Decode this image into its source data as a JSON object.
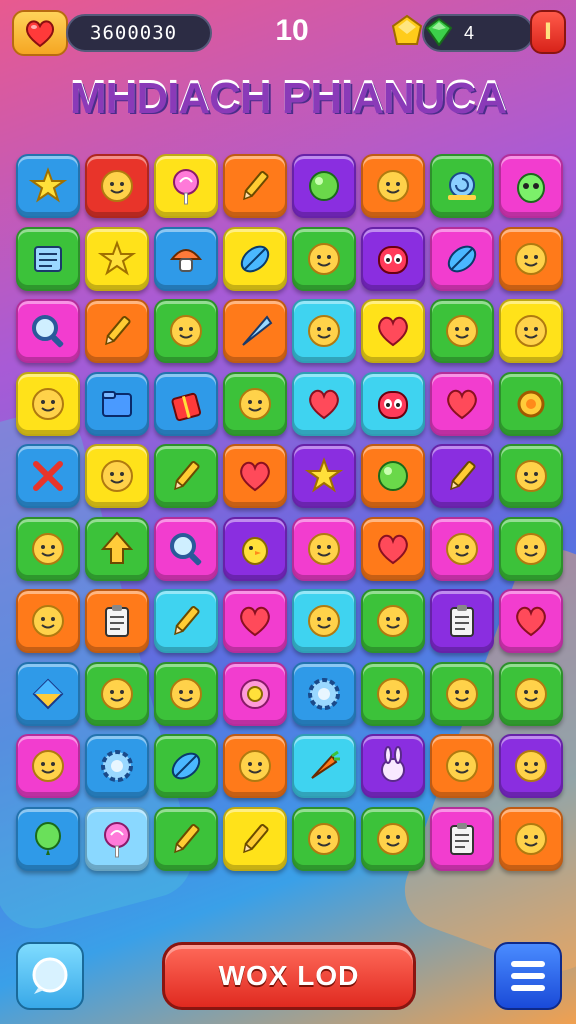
{
  "hud": {
    "score": "3600030",
    "level": "10",
    "gems": "4",
    "life_icon": "heart-icon",
    "gold_icon": "gold-gem-icon",
    "green_icon": "green-gem-icon",
    "close_label": "I"
  },
  "title": "MHDIACH PHIANUCA",
  "colors": {
    "blue": "#2f9ae8",
    "red": "#e8342a",
    "yellow": "#ffe21a",
    "orange": "#ff7a1a",
    "purple": "#8a2ee0",
    "green": "#3cc23a",
    "pink": "#f23dcf",
    "cyan": "#3fd3f0",
    "lightblue": "#8ad8ff"
  },
  "board": {
    "rows": [
      [
        {
          "c": "blue",
          "i": "star-icon"
        },
        {
          "c": "red",
          "i": "face-icon"
        },
        {
          "c": "yellow",
          "i": "lollipop-icon"
        },
        {
          "c": "orange",
          "i": "pencil-icon"
        },
        {
          "c": "purple",
          "i": "ball-icon"
        },
        {
          "c": "orange",
          "i": "face-icon"
        },
        {
          "c": "green",
          "i": "snail-icon"
        },
        {
          "c": "pink",
          "i": "alien-icon"
        }
      ],
      [
        {
          "c": "green",
          "i": "notepad-icon"
        },
        {
          "c": "yellow",
          "i": "star-icon"
        },
        {
          "c": "blue",
          "i": "mushroom-icon"
        },
        {
          "c": "yellow",
          "i": "leaf-icon"
        },
        {
          "c": "green",
          "i": "face-icon"
        },
        {
          "c": "purple",
          "i": "monster-icon"
        },
        {
          "c": "pink",
          "i": "leaf-icon"
        },
        {
          "c": "orange",
          "i": "face-icon"
        }
      ],
      [
        {
          "c": "pink",
          "i": "magnifier-icon"
        },
        {
          "c": "orange",
          "i": "pencil-icon"
        },
        {
          "c": "green",
          "i": "face-icon"
        },
        {
          "c": "orange",
          "i": "cone-icon"
        },
        {
          "c": "cyan",
          "i": "face-icon"
        },
        {
          "c": "yellow",
          "i": "heart-icon"
        },
        {
          "c": "green",
          "i": "face-icon"
        },
        {
          "c": "yellow",
          "i": "face-icon"
        }
      ],
      [
        {
          "c": "yellow",
          "i": "face-icon"
        },
        {
          "c": "blue",
          "i": "folder-icon"
        },
        {
          "c": "blue",
          "i": "gift-icon"
        },
        {
          "c": "green",
          "i": "face-icon"
        },
        {
          "c": "cyan",
          "i": "heart-icon"
        },
        {
          "c": "cyan",
          "i": "monster-icon"
        },
        {
          "c": "pink",
          "i": "heart-icon"
        },
        {
          "c": "green",
          "i": "ring-icon"
        }
      ],
      [
        {
          "c": "blue",
          "i": "cross-icon"
        },
        {
          "c": "yellow",
          "i": "face-icon"
        },
        {
          "c": "green",
          "i": "pencil-icon"
        },
        {
          "c": "orange",
          "i": "heart-icon"
        },
        {
          "c": "purple",
          "i": "star-icon"
        },
        {
          "c": "orange",
          "i": "ball-icon"
        },
        {
          "c": "purple",
          "i": "pencil-icon"
        },
        {
          "c": "green",
          "i": "face-icon"
        }
      ],
      [
        {
          "c": "green",
          "i": "face-icon"
        },
        {
          "c": "green",
          "i": "arrow-icon"
        },
        {
          "c": "pink",
          "i": "magnifier-icon"
        },
        {
          "c": "purple",
          "i": "chick-icon"
        },
        {
          "c": "pink",
          "i": "face-icon"
        },
        {
          "c": "orange",
          "i": "heart-icon"
        },
        {
          "c": "pink",
          "i": "face-icon"
        },
        {
          "c": "green",
          "i": "face-icon"
        }
      ],
      [
        {
          "c": "orange",
          "i": "face-icon"
        },
        {
          "c": "orange",
          "i": "clipboard-icon"
        },
        {
          "c": "cyan",
          "i": "pencil-icon"
        },
        {
          "c": "pink",
          "i": "heart-icon"
        },
        {
          "c": "cyan",
          "i": "face-icon"
        },
        {
          "c": "green",
          "i": "face-icon"
        },
        {
          "c": "purple",
          "i": "clipboard-icon"
        },
        {
          "c": "pink",
          "i": "heart-icon"
        }
      ],
      [
        {
          "c": "blue",
          "i": "diamond-icon"
        },
        {
          "c": "green",
          "i": "face-icon"
        },
        {
          "c": "green",
          "i": "face-icon"
        },
        {
          "c": "pink",
          "i": "flower-icon"
        },
        {
          "c": "blue",
          "i": "gear-icon"
        },
        {
          "c": "green",
          "i": "face-icon"
        },
        {
          "c": "green",
          "i": "face-icon"
        },
        {
          "c": "green",
          "i": "face-icon"
        }
      ],
      [
        {
          "c": "pink",
          "i": "face-icon"
        },
        {
          "c": "blue",
          "i": "gear-icon"
        },
        {
          "c": "green",
          "i": "leaf-icon"
        },
        {
          "c": "orange",
          "i": "face-icon"
        },
        {
          "c": "cyan",
          "i": "carrot-icon"
        },
        {
          "c": "purple",
          "i": "bunny-icon"
        },
        {
          "c": "orange",
          "i": "face-icon"
        },
        {
          "c": "purple",
          "i": "face-icon"
        }
      ],
      [
        {
          "c": "blue",
          "i": "balloon-icon"
        },
        {
          "c": "lightblue",
          "i": "lollipop-icon"
        },
        {
          "c": "green",
          "i": "pencil-icon"
        },
        {
          "c": "yellow",
          "i": "pencil-icon"
        },
        {
          "c": "green",
          "i": "face-icon"
        },
        {
          "c": "green",
          "i": "face-icon"
        },
        {
          "c": "pink",
          "i": "clipboard-icon"
        },
        {
          "c": "orange",
          "i": "face-icon"
        }
      ]
    ]
  },
  "bottom": {
    "main_button": "WOX LOD",
    "left_icon": "bubble-icon",
    "right_icon": "menu-icon"
  }
}
